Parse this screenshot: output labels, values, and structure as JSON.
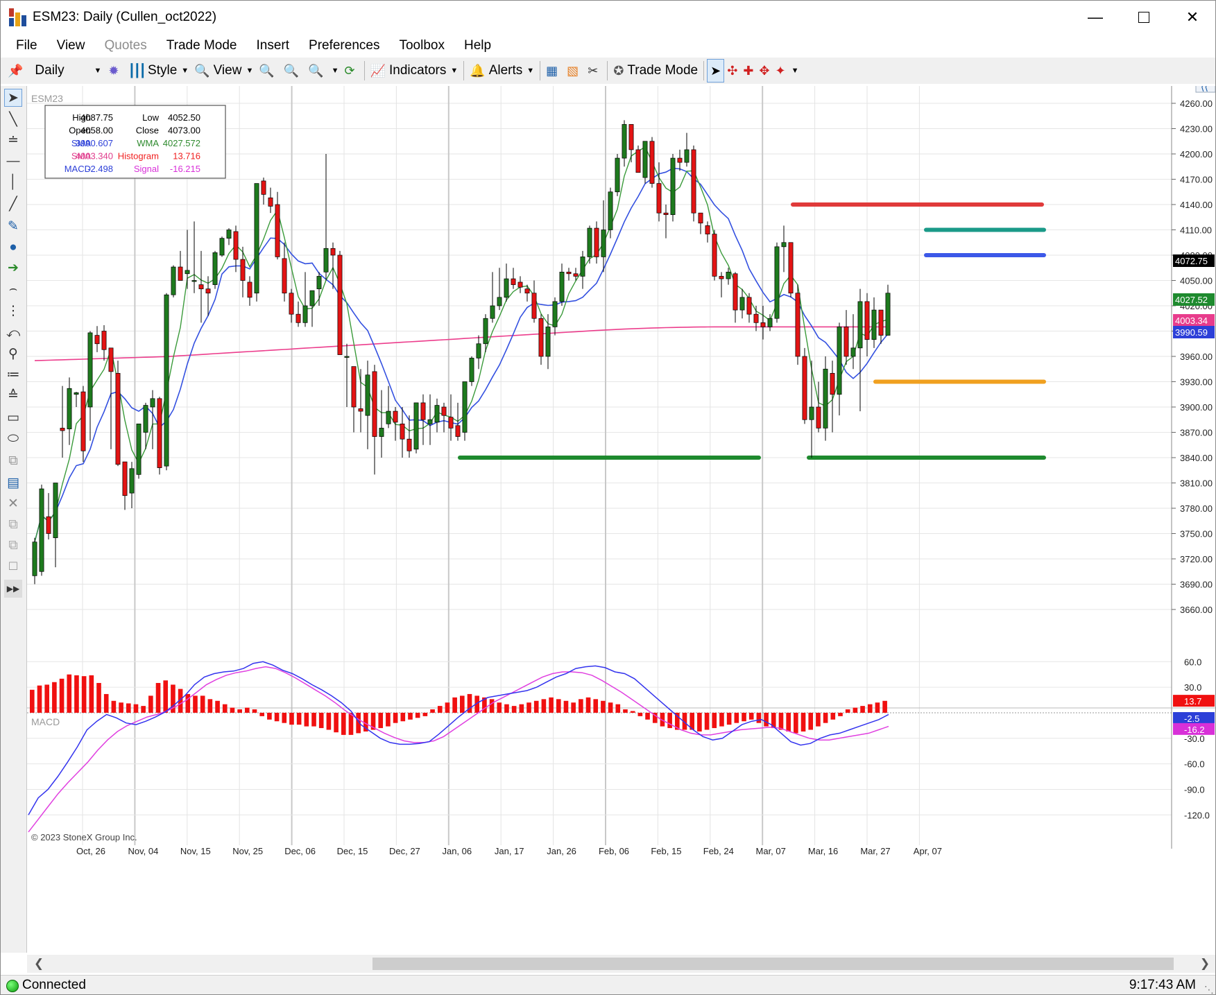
{
  "window": {
    "title": "ESM23: Daily (Cullen_oct2022)"
  },
  "menu": [
    "File",
    "View",
    "Quotes",
    "Trade Mode",
    "Insert",
    "Preferences",
    "Toolbox",
    "Help"
  ],
  "toolbar": {
    "period": "Daily",
    "style": "Style",
    "view": "View",
    "indicators": "Indicators",
    "alerts": "Alerts",
    "trade_mode": "Trade Mode"
  },
  "colors": {
    "up_candle": "#1e7a1e",
    "down_candle": "#e31414",
    "sma_fast": "#3a9a3a",
    "sma_slow": "#3350e0",
    "sma_long": "#ec3d8c",
    "macd": "#3333ee",
    "signal": "#e040e0",
    "histogram": "#f01010",
    "level_red": "#e03a3a",
    "level_teal": "#1a9a88",
    "level_blue": "#3c58e8",
    "level_orange": "#f0a020",
    "level_green": "#1e8a2e"
  },
  "data_window": {
    "rows": [
      {
        "label": "High",
        "value": "4087.75",
        "label2": "Low",
        "value2": "4052.50",
        "color": "#000000",
        "color2": "#000000"
      },
      {
        "label": "Open",
        "value": "4058.00",
        "label2": "Close",
        "value2": "4073.00",
        "color": "#000000",
        "color2": "#000000"
      },
      {
        "label": "SMA",
        "value": "3990.607",
        "label2": "WMA",
        "value2": "4027.572",
        "color": "#2c3fd8",
        "color2": "#2e8a2e"
      },
      {
        "label": "SMA",
        "value": "4003.340",
        "label2": "Histogram",
        "value2": "13.716",
        "color": "#e03c8c",
        "color2": "#f02020"
      },
      {
        "label": "MACD",
        "value": "-2.498",
        "label2": "Signal",
        "value2": "-16.215",
        "color": "#2c3fd8",
        "color2": "#d830d8"
      }
    ]
  },
  "status": {
    "connection": "Connected",
    "time": "9:17:43 AM"
  },
  "chart_data": [
    {
      "type": "candlestick",
      "title": "ESM23",
      "price_ticks": [
        4260.0,
        4230.0,
        4200.0,
        4170.0,
        4140.0,
        4110.0,
        4080.0,
        4050.0,
        4020.0,
        3990.0,
        3960.0,
        3930.0,
        3900.0,
        3870.0,
        3840.0,
        3810.0,
        3780.0,
        3750.0,
        3720.0,
        3690.0,
        3660.0
      ],
      "x_dates": [
        "Oct, 26",
        "Nov, 04",
        "Nov, 15",
        "Nov, 25",
        "Dec, 06",
        "Dec, 15",
        "Dec, 27",
        "Jan, 06",
        "Jan, 17",
        "Jan, 26",
        "Feb, 06",
        "Feb, 15",
        "Feb, 24",
        "Mar, 07",
        "Mar, 16",
        "Mar, 27",
        "Apr, 07"
      ],
      "ohlc": [
        [
          3700,
          3745,
          3690,
          3740
        ],
        [
          3705,
          3808,
          3700,
          3803
        ],
        [
          3770,
          3798,
          3743,
          3750
        ],
        [
          3745,
          3808,
          3710,
          3810
        ],
        [
          3875,
          3925,
          3840,
          3872
        ],
        [
          3874,
          3935,
          3855,
          3922
        ],
        [
          3915,
          3918,
          3900,
          3917
        ],
        [
          3918,
          3925,
          3835,
          3848
        ],
        [
          3900,
          3990,
          3860,
          3988
        ],
        [
          3985,
          3996,
          3965,
          3975
        ],
        [
          3990,
          3997,
          3955,
          3968
        ],
        [
          3970,
          3950,
          3850,
          3942
        ],
        [
          3940,
          3955,
          3830,
          3832
        ],
        [
          3835,
          3830,
          3778,
          3795
        ],
        [
          3798,
          3835,
          3780,
          3827
        ],
        [
          3820,
          3880,
          3815,
          3880
        ],
        [
          3870,
          3905,
          3850,
          3902
        ],
        [
          3900,
          3920,
          3850,
          3910
        ],
        [
          3910,
          3912,
          3820,
          3828
        ],
        [
          3830,
          4035,
          3825,
          4033
        ],
        [
          4033,
          4068,
          4030,
          4066
        ],
        [
          4066,
          4085,
          4050,
          4050
        ],
        [
          4058,
          4110,
          4040,
          4062
        ],
        [
          4050,
          4120,
          4035,
          4050
        ],
        [
          4045,
          4085,
          4000,
          4040
        ],
        [
          4040,
          4055,
          4008,
          4035
        ],
        [
          4045,
          4085,
          4040,
          4083
        ],
        [
          4080,
          4102,
          4078,
          4100
        ],
        [
          4100,
          4112,
          4092,
          4110
        ],
        [
          4108,
          4115,
          4060,
          4075
        ],
        [
          4075,
          4090,
          4030,
          4050
        ],
        [
          4048,
          4055,
          4020,
          4030
        ],
        [
          4035,
          4160,
          4025,
          4165
        ],
        [
          4168,
          4172,
          4140,
          4152
        ],
        [
          4148,
          4160,
          4130,
          4138
        ],
        [
          4140,
          4155,
          4075,
          4078
        ],
        [
          4076,
          4095,
          4025,
          4035
        ],
        [
          4035,
          4040,
          4000,
          4010
        ],
        [
          4010,
          4025,
          3995,
          4000
        ],
        [
          4000,
          4060,
          3995,
          4020
        ],
        [
          4020,
          4030,
          3995,
          4038
        ],
        [
          4040,
          4060,
          4020,
          4055
        ],
        [
          4060,
          4200,
          4050,
          4088
        ],
        [
          4088,
          4095,
          4040,
          4080
        ],
        [
          4080,
          4085,
          3972,
          3962
        ],
        [
          3960,
          3975,
          3900,
          3960
        ],
        [
          3948,
          3935,
          3870,
          3900
        ],
        [
          3898,
          3945,
          3870,
          3895
        ],
        [
          3890,
          3955,
          3850,
          3938
        ],
        [
          3942,
          3950,
          3820,
          3865
        ],
        [
          3865,
          3920,
          3840,
          3875
        ],
        [
          3880,
          3925,
          3875,
          3895
        ],
        [
          3895,
          3900,
          3860,
          3882
        ],
        [
          3880,
          3900,
          3840,
          3862
        ],
        [
          3862,
          3890,
          3840,
          3848
        ],
        [
          3850,
          3905,
          3845,
          3905
        ],
        [
          3905,
          3915,
          3855,
          3885
        ],
        [
          3880,
          3915,
          3855,
          3885
        ],
        [
          3882,
          3910,
          3870,
          3902
        ],
        [
          3900,
          3905,
          3870,
          3890
        ],
        [
          3888,
          3915,
          3860,
          3875
        ],
        [
          3878,
          3905,
          3860,
          3865
        ],
        [
          3870,
          3930,
          3860,
          3930
        ],
        [
          3930,
          3960,
          3925,
          3958
        ],
        [
          3958,
          3985,
          3945,
          3975
        ],
        [
          3975,
          4010,
          3965,
          4005
        ],
        [
          4005,
          4060,
          4000,
          4020
        ],
        [
          4020,
          4065,
          4015,
          4030
        ],
        [
          4030,
          4070,
          4025,
          4052
        ],
        [
          4052,
          4065,
          4040,
          4045
        ],
        [
          4048,
          4055,
          4035,
          4042
        ],
        [
          4040,
          4045,
          4025,
          4035
        ],
        [
          4035,
          4050,
          4000,
          4005
        ],
        [
          4005,
          4010,
          3950,
          3960
        ],
        [
          3960,
          4010,
          3945,
          3995
        ],
        [
          3995,
          4030,
          3985,
          4025
        ],
        [
          4025,
          4070,
          4020,
          4060
        ],
        [
          4060,
          4065,
          4050,
          4058
        ],
        [
          4058,
          4065,
          4050,
          4055
        ],
        [
          4055,
          4085,
          4040,
          4078
        ],
        [
          4078,
          4115,
          4070,
          4112
        ],
        [
          4112,
          4120,
          4070,
          4078
        ],
        [
          4078,
          4145,
          4060,
          4110
        ],
        [
          4110,
          4160,
          4100,
          4155
        ],
        [
          4155,
          4200,
          4150,
          4195
        ],
        [
          4195,
          4240,
          4185,
          4235
        ],
        [
          4235,
          4220,
          4190,
          4205
        ],
        [
          4205,
          4210,
          4180,
          4178
        ],
        [
          4172,
          4210,
          4165,
          4215
        ],
        [
          4215,
          4220,
          4160,
          4165
        ],
        [
          4165,
          4190,
          4120,
          4130
        ],
        [
          4130,
          4140,
          4100,
          4128
        ],
        [
          4128,
          4200,
          4120,
          4195
        ],
        [
          4195,
          4205,
          4180,
          4190
        ],
        [
          4190,
          4225,
          4185,
          4205
        ],
        [
          4205,
          4210,
          4120,
          4130
        ],
        [
          4130,
          4125,
          4105,
          4118
        ],
        [
          4115,
          4120,
          4095,
          4105
        ],
        [
          4105,
          4110,
          4050,
          4055
        ],
        [
          4055,
          4060,
          4030,
          4052
        ],
        [
          4052,
          4065,
          4045,
          4060
        ],
        [
          4058,
          4060,
          4000,
          4015
        ],
        [
          4015,
          4040,
          4005,
          4030
        ],
        [
          4030,
          4035,
          4000,
          4010
        ],
        [
          4010,
          4020,
          3990,
          4000
        ],
        [
          4000,
          4020,
          3980,
          3995
        ],
        [
          3995,
          4010,
          3990,
          4005
        ],
        [
          4005,
          4095,
          4000,
          4090
        ],
        [
          4090,
          4115,
          4060,
          4095
        ],
        [
          4095,
          4095,
          4030,
          4035
        ],
        [
          4035,
          4045,
          3950,
          3960
        ],
        [
          3960,
          3970,
          3880,
          3885
        ],
        [
          3885,
          3955,
          3840,
          3900
        ],
        [
          3900,
          3930,
          3870,
          3875
        ],
        [
          3875,
          3960,
          3860,
          3945
        ],
        [
          3940,
          3955,
          3870,
          3915
        ],
        [
          3915,
          4000,
          3890,
          3995
        ],
        [
          3995,
          4015,
          3950,
          3960
        ],
        [
          3960,
          4010,
          3945,
          3970
        ],
        [
          3970,
          4040,
          3895,
          4025
        ],
        [
          4025,
          4035,
          3960,
          3980
        ],
        [
          3980,
          4030,
          3970,
          4015
        ],
        [
          4015,
          4015,
          3975,
          3985
        ],
        [
          3985,
          4045,
          3990,
          4035
        ]
      ],
      "overlay_lines": {
        "sma_slow_end": 3990.607,
        "wma_end": 4027.572,
        "sma_long_end": 4003.34
      },
      "horizontal_levels": [
        {
          "value": 4140,
          "color": "#e03a3a"
        },
        {
          "value": 4110,
          "color": "#1a9a88"
        },
        {
          "value": 4080,
          "color": "#3c58e8"
        },
        {
          "value": 3930,
          "color": "#f0a020"
        },
        {
          "value": 3840,
          "color": "#1e8a2e"
        },
        {
          "value": 3840,
          "color": "#1e8a2e"
        }
      ],
      "tags": [
        {
          "label": "4072.75",
          "bg": "#000000",
          "fg": "#ffffff",
          "value": 4072.75
        },
        {
          "label": "4027.52",
          "bg": "#1e8a2e",
          "fg": "#ffffff",
          "value": 4027.52
        },
        {
          "label": "4003.34",
          "bg": "#e83c8c",
          "fg": "#ffffff",
          "value": 4003.34
        },
        {
          "label": "3990.59",
          "bg": "#2c3fd8",
          "fg": "#ffffff",
          "value": 3990.59
        }
      ]
    },
    {
      "type": "bar+line",
      "title": "MACD",
      "copyright": "© 2023 StoneX Group Inc.",
      "ticks": [
        "60.0",
        "30.0",
        "-30.0",
        "-60.0",
        "-90.0",
        "-120.0"
      ],
      "tick_values": [
        60,
        30,
        -30,
        -60,
        -90,
        -120
      ],
      "ylim": [
        -145,
        70
      ],
      "histogram": [
        27,
        32,
        33,
        36,
        40,
        45,
        44,
        43,
        44,
        35,
        22,
        14,
        12,
        11,
        10,
        8,
        20,
        35,
        38,
        33,
        28,
        22,
        20,
        20,
        16,
        14,
        10,
        6,
        4,
        6,
        4,
        -4,
        -8,
        -10,
        -12,
        -14,
        -14,
        -16,
        -16,
        -18,
        -20,
        -23,
        -26,
        -26,
        -24,
        -22,
        -20,
        -18,
        -16,
        -12,
        -10,
        -8,
        -6,
        -4,
        4,
        8,
        12,
        18,
        20,
        22,
        20,
        18,
        16,
        12,
        10,
        8,
        10,
        12,
        14,
        16,
        18,
        16,
        14,
        12,
        16,
        18,
        16,
        14,
        12,
        10,
        4,
        2,
        -4,
        -8,
        -12,
        -16,
        -18,
        -20,
        -20,
        -20,
        -22,
        -20,
        -18,
        -16,
        -14,
        -12,
        -10,
        -8,
        -12,
        -16,
        -18,
        -20,
        -22,
        -24,
        -22,
        -20,
        -16,
        -12,
        -8,
        -4,
        4,
        6,
        8,
        10,
        12,
        14
      ],
      "macd_line": [
        -120,
        -100,
        -90,
        -75,
        -58,
        -40,
        -20,
        -10,
        -2,
        -6,
        -12,
        -14,
        -10,
        -5,
        1,
        10,
        20,
        33,
        42,
        46,
        48,
        49,
        52,
        58,
        60,
        56,
        50,
        46,
        40,
        33,
        27,
        20,
        12,
        2,
        -14,
        -22,
        -30,
        -35,
        -37,
        -37,
        -36,
        -34,
        -25,
        -15,
        -5,
        4,
        12,
        18,
        20,
        22,
        24,
        26,
        30,
        36,
        42,
        46,
        52,
        54,
        55,
        53,
        48,
        46,
        40,
        30,
        20,
        10,
        0,
        -10,
        -20,
        -28,
        -32,
        -30,
        -22,
        -14,
        -10,
        -8,
        -14,
        -24,
        -34,
        -38,
        -36,
        -30,
        -26,
        -24,
        -20,
        -16,
        -12,
        -8,
        -2
      ],
      "signal_line": [
        -140,
        -125,
        -110,
        -95,
        -82,
        -70,
        -58,
        -44,
        -32,
        -22,
        -15,
        -10,
        -5,
        -2,
        2,
        8,
        15,
        24,
        33,
        39,
        44,
        47,
        49,
        52,
        54,
        52,
        47,
        41,
        34,
        27,
        20,
        12,
        3,
        -5,
        -12,
        -18,
        -24,
        -29,
        -33,
        -35,
        -35,
        -33,
        -28,
        -20,
        -12,
        -4,
        4,
        12,
        18,
        24,
        30,
        36,
        42,
        46,
        48,
        48,
        47,
        44,
        38,
        31,
        24,
        16,
        8,
        0,
        -8,
        -14,
        -20,
        -24,
        -26,
        -26,
        -24,
        -22,
        -20,
        -19,
        -18,
        -17,
        -18,
        -22,
        -26,
        -30,
        -32,
        -32,
        -30,
        -28,
        -26,
        -24,
        -20,
        -16
      ]
    }
  ]
}
